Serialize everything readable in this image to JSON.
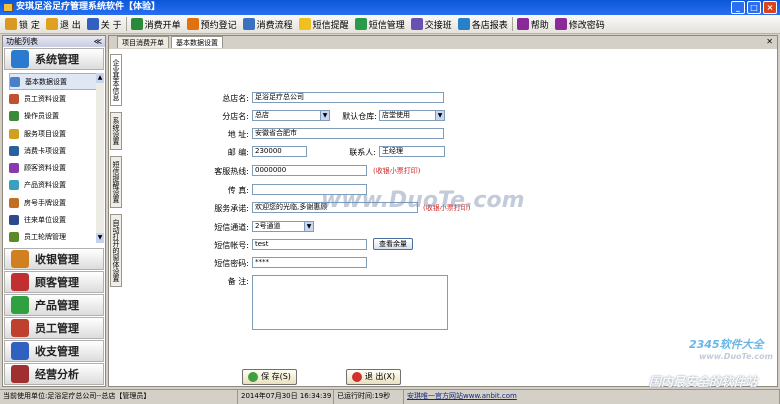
{
  "window": {
    "title": "安琪足浴足疗管理系统软件【体验】",
    "buttons": [
      "_",
      "□",
      "×"
    ]
  },
  "menu": [
    {
      "label": "锁 定",
      "icon": "lock-icon",
      "color": "#d89a20"
    },
    {
      "label": "退 出",
      "icon": "exit-icon",
      "color": "#e0a020"
    },
    {
      "label": "关 于",
      "icon": "info-icon",
      "color": "#3060c0"
    },
    {
      "label": "消费开单",
      "icon": "order-icon",
      "color": "#2a8a3a"
    },
    {
      "label": "预约登记",
      "icon": "clock-icon",
      "color": "#e07010"
    },
    {
      "label": "消费流程",
      "icon": "flow-icon",
      "color": "#3a70c0"
    },
    {
      "label": "短信提醒",
      "icon": "warning-icon",
      "color": "#f0c020"
    },
    {
      "label": "短信管理",
      "icon": "sms-icon",
      "color": "#2a9a4a"
    },
    {
      "label": "交接班",
      "icon": "shift-icon",
      "color": "#6a50b0"
    },
    {
      "label": "各店报表",
      "icon": "report-icon",
      "color": "#2a80c8"
    },
    {
      "label": "帮助",
      "icon": "help-icon",
      "color": "#8a2a9a"
    },
    {
      "label": "修改密码",
      "icon": "password-icon",
      "color": "#8a2a9a"
    }
  ],
  "leftpanel": {
    "title": "功能列表",
    "categories_top": [
      {
        "label": "系统管理",
        "icon": "windows-icon",
        "color": "#2a7ad0"
      }
    ],
    "subitems": [
      {
        "label": "基本数据设置",
        "color": "#4a80c8"
      },
      {
        "label": "员工资料设置",
        "color": "#c05030"
      },
      {
        "label": "操作员设置",
        "color": "#3a8a3a"
      },
      {
        "label": "服务项目设置",
        "color": "#d0a020"
      },
      {
        "label": "消费卡项设置",
        "color": "#2a60a0"
      },
      {
        "label": "顾客资料设置",
        "color": "#8a3ab0"
      },
      {
        "label": "产品资料设置",
        "color": "#3aa0c0"
      },
      {
        "label": "房号手牌设置",
        "color": "#c07020"
      },
      {
        "label": "往来单位设置",
        "color": "#2a4a8a"
      },
      {
        "label": "员工轮牌管理",
        "color": "#5a8a2a"
      }
    ],
    "categories_bottom": [
      {
        "label": "收银管理",
        "icon": "cashier-icon",
        "color": "#d08020"
      },
      {
        "label": "顾客管理",
        "icon": "customer-icon",
        "color": "#c03030"
      },
      {
        "label": "产品管理",
        "icon": "product-icon",
        "color": "#30a040"
      },
      {
        "label": "员工管理",
        "icon": "staff-icon",
        "color": "#c04030"
      },
      {
        "label": "收支管理",
        "icon": "finance-icon",
        "color": "#3060c0"
      },
      {
        "label": "经营分析",
        "icon": "analysis-icon",
        "color": "#a03030"
      }
    ]
  },
  "tabs": [
    "项目消费开单",
    "基本数据设置"
  ],
  "vtabs": [
    "企业基本信息",
    "系统设置",
    "短信提醒设置",
    "自动打开的窗体设置"
  ],
  "form": {
    "store_label": "总店名:",
    "store_value": "足浴足疗总公司",
    "branch_label": "分店名:",
    "branch_value": "总店",
    "warehouse_label": "默认仓库:",
    "warehouse_value": "店堂使用",
    "address_label": "地  址:",
    "address_value": "安徽省合肥市",
    "zip_label": "邮  编:",
    "zip_value": "230000",
    "contact_label": "联系人:",
    "contact_value": "王经理",
    "hotline_label": "客服热线:",
    "hotline_value": "0000000",
    "hotline_note": "(收银小票打印)",
    "fax_label": "传  真:",
    "fax_value": "",
    "promise_label": "服务承诺:",
    "promise_value": "欢迎您的光临,多谢惠顾",
    "promise_note": "(收银小票打印)",
    "channel_label": "短信通道:",
    "channel_value": "2号通道",
    "account_label": "短信帐号:",
    "account_value": "test",
    "balance_button": "查看余量",
    "password_label": "短信密码:",
    "password_value": "****",
    "remark_label": "备  注:",
    "remark_value": ""
  },
  "buttons": {
    "save": "保 存(S)",
    "exit": "退 出(X)"
  },
  "status": {
    "unit": "当前使用单位:足浴足疗总公司--总店【管理员】",
    "datetime": "2014年07月30日  16:34:39",
    "elapsed": "已运行时间:19秒",
    "site": "安琪唯一官方网站www.anbit.com"
  },
  "watermarks": [
    "www.DuoTe.com",
    "2345软件大全",
    "www.DuoTe.com",
    "国内最安全的软件站"
  ]
}
